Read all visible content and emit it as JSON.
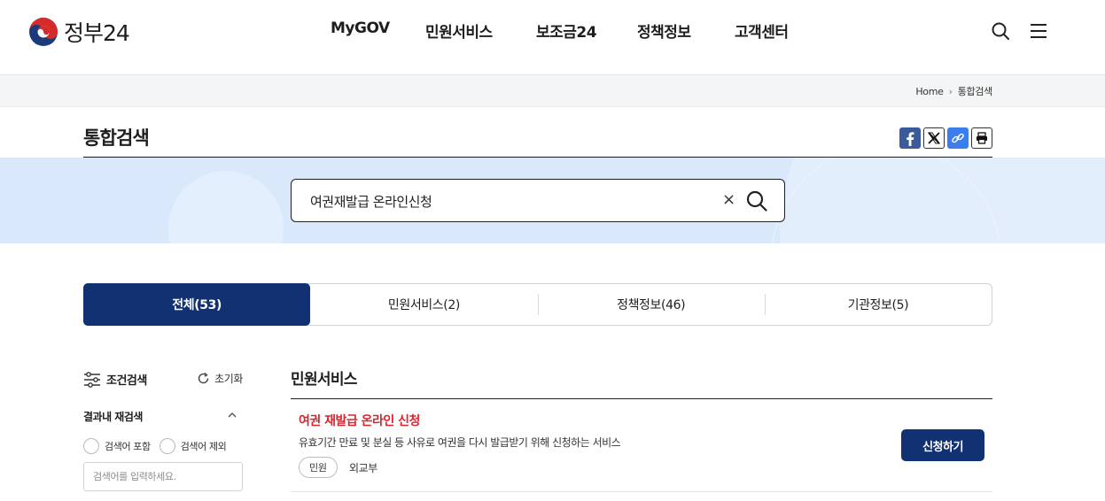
{
  "header": {
    "logo_text": "정부24",
    "nav": [
      "MyGOV",
      "민원서비스",
      "보조금24",
      "정책정보",
      "고객센터"
    ],
    "icons": {
      "search": "search-icon",
      "menu": "hamburger-menu-icon"
    }
  },
  "breadcrumb": {
    "home": "Home",
    "current": "통합검색"
  },
  "page": {
    "title": "통합검색"
  },
  "share": [
    "facebook-icon",
    "x-icon",
    "link-icon",
    "print-icon"
  ],
  "search": {
    "value": "여권재발급 온라인신청",
    "clear": "×"
  },
  "tabs": [
    {
      "label": "전체(53)",
      "active": true
    },
    {
      "label": "민원서비스(2)",
      "active": false
    },
    {
      "label": "정책정보(46)",
      "active": false
    },
    {
      "label": "기관정보(5)",
      "active": false
    }
  ],
  "filter": {
    "title": "조건검색",
    "reset": "초기화",
    "subsection": "결과내 재검색",
    "options": [
      "검색어 포함",
      "검색어 제외"
    ],
    "placeholder": "검색어를 입력하세요."
  },
  "results": {
    "section": "민원서비스",
    "items": [
      {
        "title": "여권 재발급 온라인 신청",
        "desc": "유효기간 만료 및 분실 등 사유로 여권을 다시 발급받기 위해 신청하는 서비스",
        "tag": "민원",
        "org": "외교부",
        "action": "신청하기"
      }
    ]
  },
  "colors": {
    "primary": "#123173",
    "accent_red": "#d8262f",
    "band": "#d9e9fb"
  }
}
